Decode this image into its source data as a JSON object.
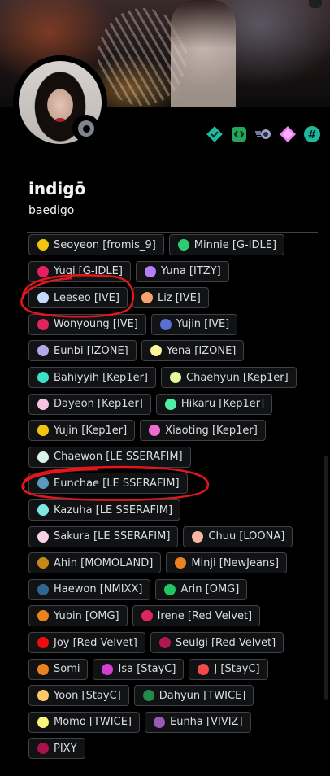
{
  "profile": {
    "display_name": "indigō",
    "username": "baedigo",
    "status": "offline",
    "badges": [
      "diamond-check-icon",
      "code-bracket-icon",
      "speed-orb-icon",
      "pink-gem-icon",
      "hashtag-icon"
    ]
  },
  "colors": {
    "background": "#000000",
    "pill_bg": "#111214",
    "pill_border": "#3f4147",
    "annotation": "#e3161b",
    "badge_teal": "#23a55a"
  },
  "roles": [
    [
      {
        "label": "Seoyeon [fromis_9]",
        "color": "#f1c40f"
      },
      {
        "label": "Minnie [G-IDLE]",
        "color": "#2ecc71"
      }
    ],
    [
      {
        "label": "Yuqi [G-IDLE]",
        "color": "#e91e63"
      },
      {
        "label": "Yuna [ITZY]",
        "color": "#b57ffc"
      }
    ],
    [
      {
        "label": "Leeseo [IVE]",
        "color": "#c5d9fb"
      },
      {
        "label": "Liz [IVE]",
        "color": "#f9a36b"
      }
    ],
    [
      {
        "label": "Wonyoung [IVE]",
        "color": "#e0245e"
      },
      {
        "label": "Yujin [IVE]",
        "color": "#5b6ed4"
      }
    ],
    [
      {
        "label": "Eunbi [IZONE]",
        "color": "#b6a6e6"
      },
      {
        "label": "Yena [IZONE]",
        "color": "#fff59b"
      }
    ],
    [
      {
        "label": "Bahiyyih [Kep1er]",
        "color": "#3de1c8"
      },
      {
        "label": "Chaehyun [Kep1er]",
        "color": "#e4f99a"
      }
    ],
    [
      {
        "label": "Dayeon [Kep1er]",
        "color": "#f8c3e2"
      },
      {
        "label": "Hikaru [Kep1er]",
        "color": "#4ff0a5"
      }
    ],
    [
      {
        "label": "Yujin [Kep1er]",
        "color": "#f1c40f"
      },
      {
        "label": "Xiaoting [Kep1er]",
        "color": "#f06bd1"
      }
    ],
    [
      {
        "label": "Chaewon [LE SSERAFIM]",
        "color": "#d9f3e6"
      }
    ],
    [
      {
        "label": "Eunchae [LE SSERAFIM]",
        "color": "#5a98be"
      }
    ],
    [
      {
        "label": "Kazuha [LE SSERAFIM]",
        "color": "#7ee7e1"
      }
    ],
    [
      {
        "label": "Sakura [LE SSERAFIM]",
        "color": "#fbd3e4"
      },
      {
        "label": "Chuu [LOONA]",
        "color": "#f9b7a2"
      }
    ],
    [
      {
        "label": "Ahin [MOMOLAND]",
        "color": "#c4891a"
      },
      {
        "label": "Minji [NewJeans]",
        "color": "#e9821f"
      }
    ],
    [
      {
        "label": "Haewon [NMIXX]",
        "color": "#2e6592"
      },
      {
        "label": "Arin [OMG]",
        "color": "#1fc865"
      }
    ],
    [
      {
        "label": "Yubin [OMG]",
        "color": "#e9821f"
      },
      {
        "label": "Irene [Red Velvet]",
        "color": "#e0245e"
      }
    ],
    [
      {
        "label": "Joy [Red Velvet]",
        "color": "#ee0c0c"
      },
      {
        "label": "Seulgi [Red Velvet]",
        "color": "#b0174f"
      }
    ],
    [
      {
        "label": "Somi",
        "color": "#e9821f"
      },
      {
        "label": "Isa [StayC]",
        "color": "#d93cd3"
      },
      {
        "label": "J [StayC]",
        "color": "#f24a4a"
      }
    ],
    [
      {
        "label": "Yoon [StayC]",
        "color": "#fcc86a"
      },
      {
        "label": "Dahyun [TWICE]",
        "color": "#228b4a"
      }
    ],
    [
      {
        "label": "Momo [TWICE]",
        "color": "#fcf77a"
      },
      {
        "label": "Eunha [VIVIZ]",
        "color": "#9b59b6"
      }
    ],
    [
      {
        "label": "PIXY",
        "color": "#a8124f"
      }
    ]
  ]
}
